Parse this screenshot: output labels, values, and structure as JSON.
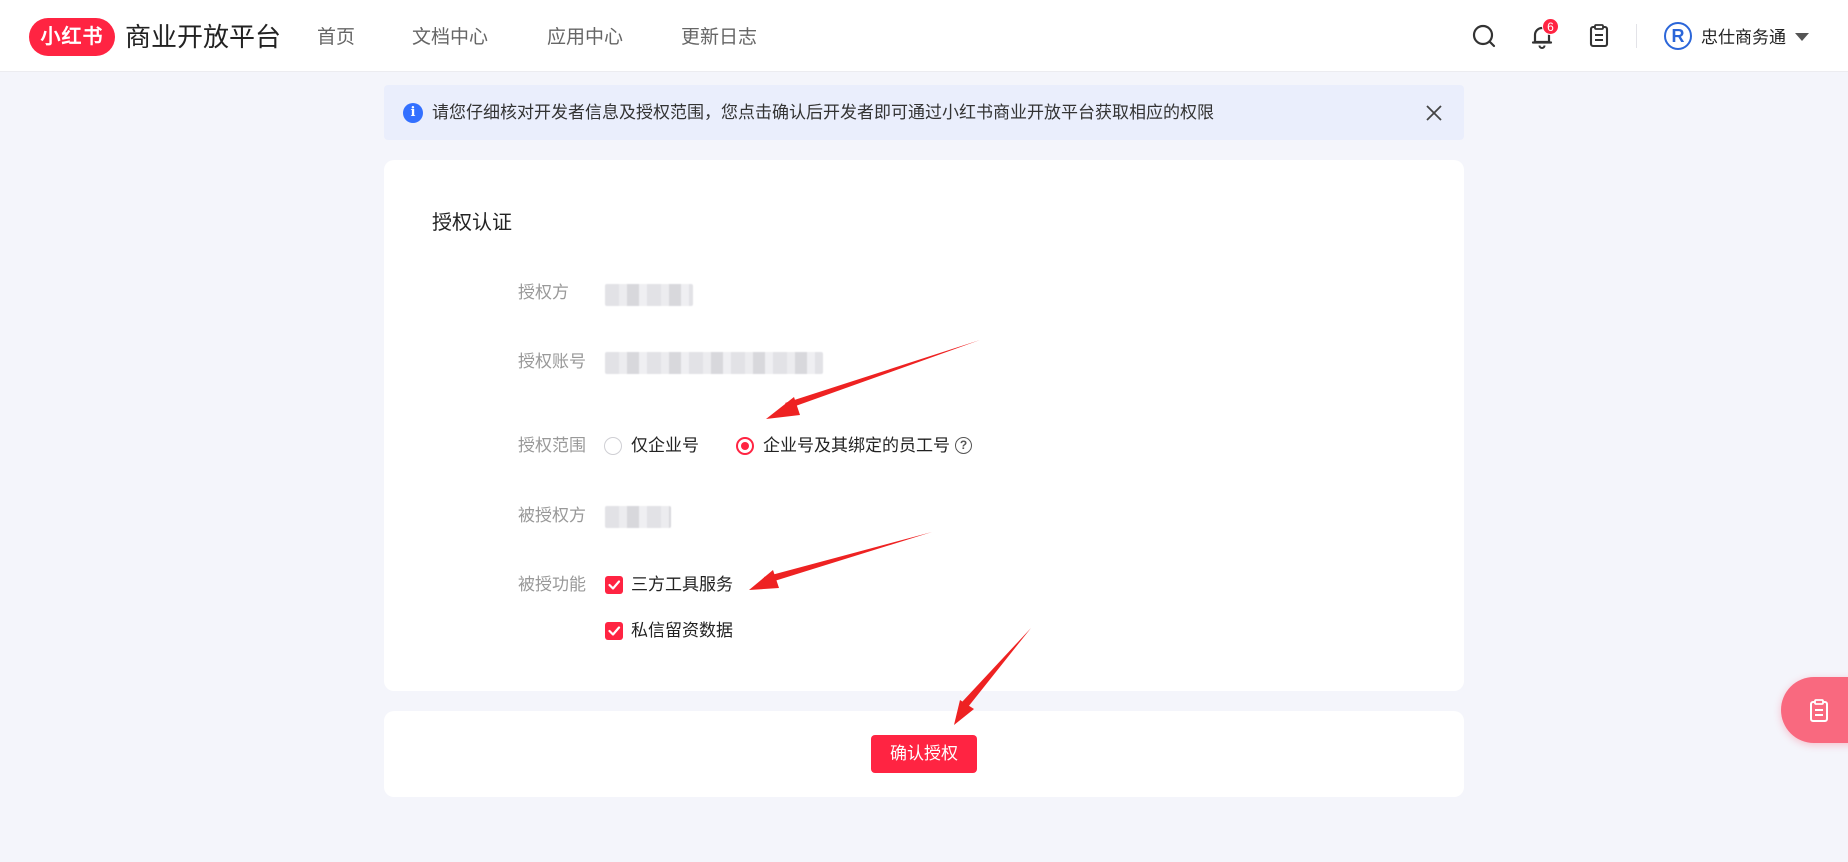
{
  "header": {
    "logo_text": "小红书",
    "platform_title": "商业开放平台",
    "nav": [
      "首页",
      "文档中心",
      "应用中心",
      "更新日志"
    ],
    "notification_count": "6",
    "avatar_letter": "R",
    "user_name": "忠仕商务通",
    "icons": [
      "search-icon",
      "bell-icon",
      "clipboard-icon",
      "chevron-down-icon"
    ]
  },
  "notice": {
    "text": "请您仔细核对开发者信息及授权范围，您点击确认后开发者即可通过小红书商业开放平台获取相应的权限",
    "icon": "info-icon"
  },
  "form": {
    "title": "授权认证",
    "authorizer_label": "授权方",
    "account_label": "授权账号",
    "scope_label": "授权范围",
    "scope_options": [
      "仅企业号",
      "企业号及其绑定的员工号"
    ],
    "scope_selected": "企业号及其绑定的员工号",
    "grantee_label": "被授权方",
    "function_label": "被授功能",
    "functions": [
      "三方工具服务",
      "私信留资数据"
    ],
    "functions_checked": [
      true,
      true
    ]
  },
  "actions": {
    "confirm_label": "确认授权"
  },
  "colors": {
    "brand": "#ff2442",
    "notice_bg": "#eaeefc",
    "info": "#3370ff",
    "page_bg": "#f4f5fb"
  }
}
